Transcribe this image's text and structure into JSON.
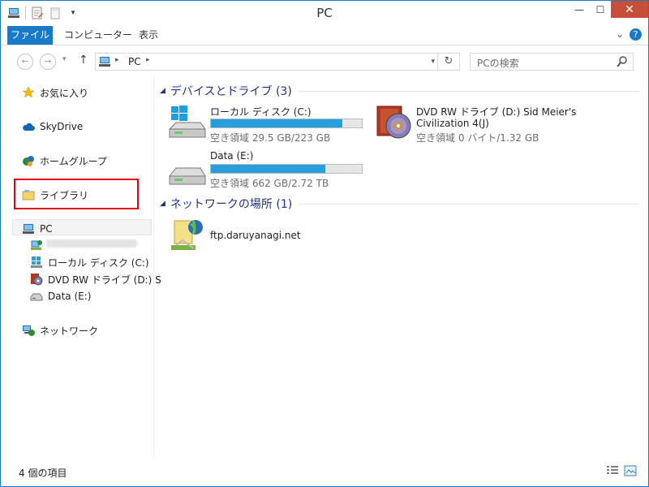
{
  "window": {
    "title": "PC"
  },
  "ribbon": {
    "tabs": [
      {
        "label": "ファイル"
      },
      {
        "label": "コンピューター"
      },
      {
        "label": "表示"
      }
    ]
  },
  "address": {
    "breadcrumb": [
      "PC"
    ],
    "search_placeholder": "PCの検索"
  },
  "navpane": {
    "items": [
      {
        "label": "お気に入り"
      },
      {
        "label": "SkyDrive"
      },
      {
        "label": "ホームグループ"
      },
      {
        "label": "ライブラリ"
      },
      {
        "label": "PC"
      },
      {
        "label": "ローカル ディスク (C:)"
      },
      {
        "label": "DVD RW ドライブ (D:) S"
      },
      {
        "label": "Data (E:)"
      },
      {
        "label": "ネットワーク"
      }
    ]
  },
  "content": {
    "groups": [
      {
        "title": "デバイスとドライブ (3)"
      },
      {
        "title": "ネットワークの場所 (1)"
      }
    ],
    "drives": [
      {
        "name": "ローカル ディスク (C:)",
        "free": "空き領域 29.5 GB/223 GB",
        "used_fraction": 0.87
      },
      {
        "name": "DVD RW ドライブ (D:) Sid Meier's",
        "name2": "Civilization 4(J)",
        "free": "空き領域 0 バイト/1.32 GB"
      },
      {
        "name": "Data (E:)",
        "free": "空き領域 662 GB/2.72 TB",
        "used_fraction": 0.76
      }
    ],
    "network_locations": [
      {
        "name": "ftp.daruyanagi.net"
      }
    ]
  },
  "statusbar": {
    "count": "4 個の項目"
  },
  "colors": {
    "accent": "#1979ca",
    "group_title": "#1e3287",
    "bar_fill": "#26a0da",
    "highlight_box": "#e60012"
  }
}
